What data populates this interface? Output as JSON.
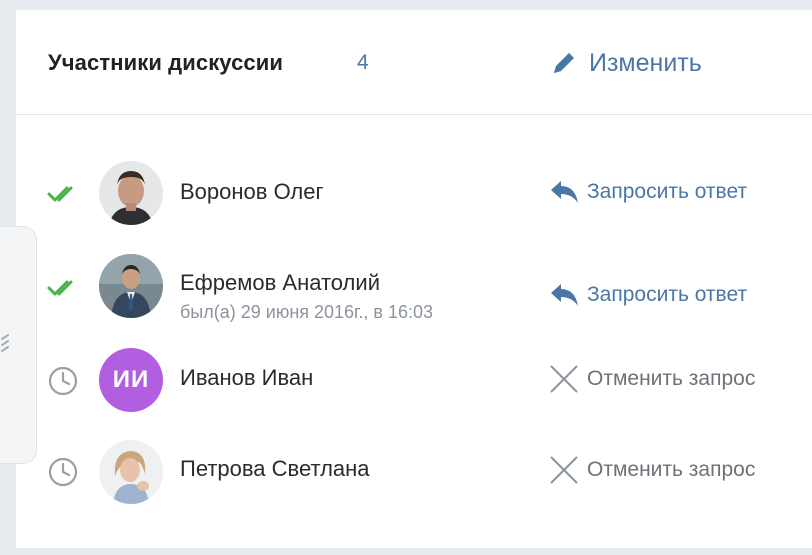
{
  "header": {
    "title": "Участники дискуссии",
    "count": "4",
    "edit_label": "Изменить"
  },
  "participants": [
    {
      "name": "Воронов Олег",
      "subtitle": "",
      "status_icon": "double-check-icon",
      "avatar": "photo",
      "action_label": "Запросить ответ",
      "action_icon": "reply-arrow-icon"
    },
    {
      "name": "Ефремов Анатолий",
      "subtitle": "был(а) 29 июня 2016г., в 16:03",
      "status_icon": "double-check-icon",
      "avatar": "photo",
      "action_label": "Запросить ответ",
      "action_icon": "reply-arrow-icon"
    },
    {
      "name": "Иванов Иван",
      "subtitle": "",
      "status_icon": "clock-icon",
      "avatar": "initials",
      "initials": "ИИ",
      "action_label": "Отменить запрос",
      "action_icon": "close-x-icon"
    },
    {
      "name": "Петрова Светлана",
      "subtitle": "",
      "status_icon": "clock-icon",
      "avatar": "photo",
      "action_label": "Отменить запрос",
      "action_icon": "close-x-icon"
    }
  ],
  "colors": {
    "accent": "#4a76a8",
    "check_green": "#4bb34b",
    "initials_avatar": "#b15fe0",
    "muted": "#8c939b"
  }
}
